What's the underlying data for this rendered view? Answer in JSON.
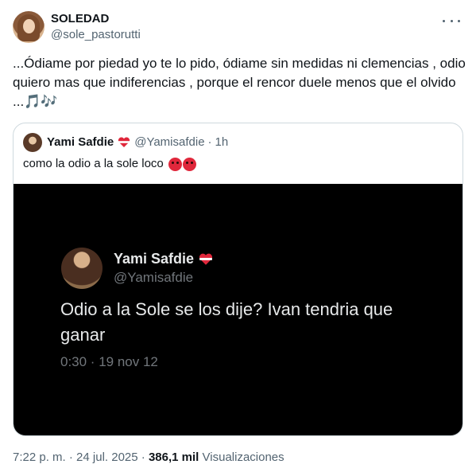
{
  "tweet": {
    "author": {
      "display_name": "SOLEDAD",
      "handle": "@sole_pastorutti"
    },
    "text": "...Ódiame por piedad yo te lo pido, ódiame sin medidas ni clemencias , odio quiero mas que indiferencias , porque el rencor duele menos que el olvido ...",
    "trailing_emoji": "🎵🎶",
    "quote": {
      "display_name": "Yami Safdie",
      "handle": "@Yamisafdie",
      "separator": "·",
      "time": "1h",
      "text": "como la odio a la sole loco",
      "media": {
        "display_name": "Yami Safdie",
        "handle": "@Yamisafdie",
        "text": "Odio a la Sole se los dije? Ivan tendria que ganar",
        "timestamp": "0:30 · 19 nov 12"
      }
    },
    "meta": {
      "time": "7:22 p. m.",
      "dot1": "·",
      "date": "24 jul. 2025",
      "dot2": "·",
      "views_count": "386,1 mil",
      "views_label": "Visualizaciones"
    }
  },
  "icons": {
    "more": "more-horizontal-icon",
    "heart": "heart-flag-icon",
    "angry": "angry-face-icon",
    "music": "music-notes-icon"
  },
  "colors": {
    "accent": "#1d9bf0",
    "text_secondary": "#536471",
    "media_bg": "#000000"
  }
}
